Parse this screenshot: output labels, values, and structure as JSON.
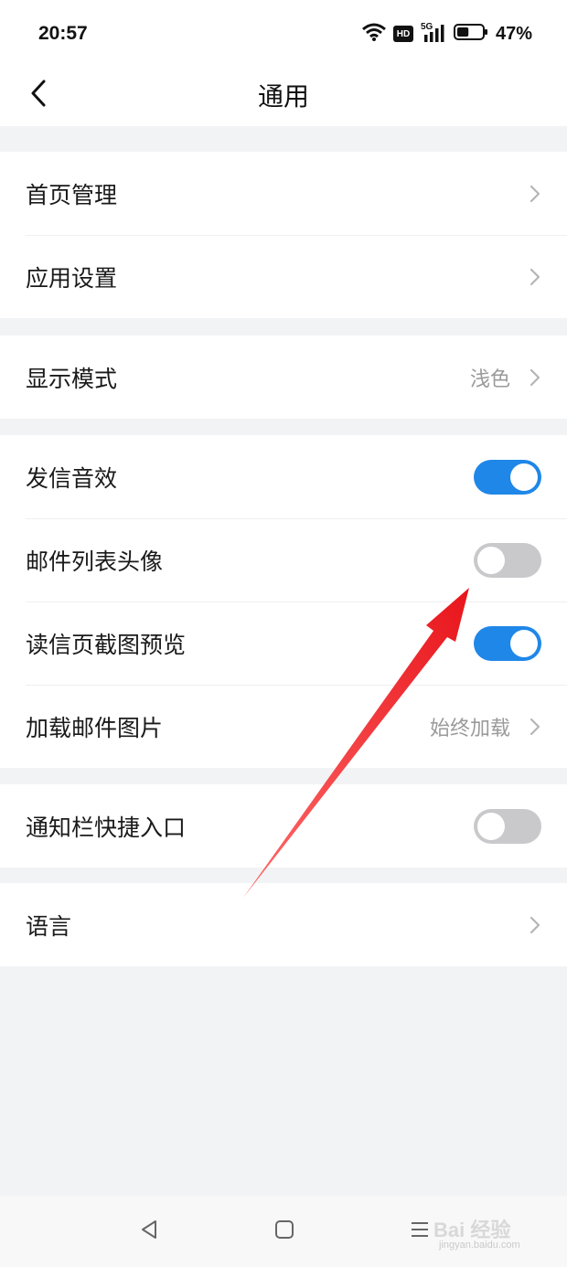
{
  "status_bar": {
    "time": "20:57",
    "hd_badge": "HD",
    "network": "5G",
    "battery_percent": "47%",
    "battery_level": 0.47
  },
  "header": {
    "title": "通用"
  },
  "groups": [
    {
      "items": [
        {
          "label": "首页管理",
          "type": "link"
        },
        {
          "label": "应用设置",
          "type": "link"
        }
      ]
    },
    {
      "items": [
        {
          "label": "显示模式",
          "value": "浅色",
          "type": "link"
        }
      ]
    },
    {
      "items": [
        {
          "label": "发信音效",
          "type": "toggle",
          "checked": true
        },
        {
          "label": "邮件列表头像",
          "type": "toggle",
          "checked": false
        },
        {
          "label": "读信页截图预览",
          "type": "toggle",
          "checked": true
        },
        {
          "label": "加载邮件图片",
          "value": "始终加载",
          "type": "link"
        }
      ]
    },
    {
      "items": [
        {
          "label": "通知栏快捷入口",
          "type": "toggle",
          "checked": false
        }
      ]
    },
    {
      "items": [
        {
          "label": "语言",
          "type": "link"
        }
      ]
    }
  ],
  "watermark": {
    "text": "Bai 经验",
    "sub": "jingyan.baidu.com"
  },
  "colors": {
    "toggle_on": "#1f87e8",
    "toggle_off": "#c9c9cc",
    "annotation_arrow": "#e8151b"
  }
}
